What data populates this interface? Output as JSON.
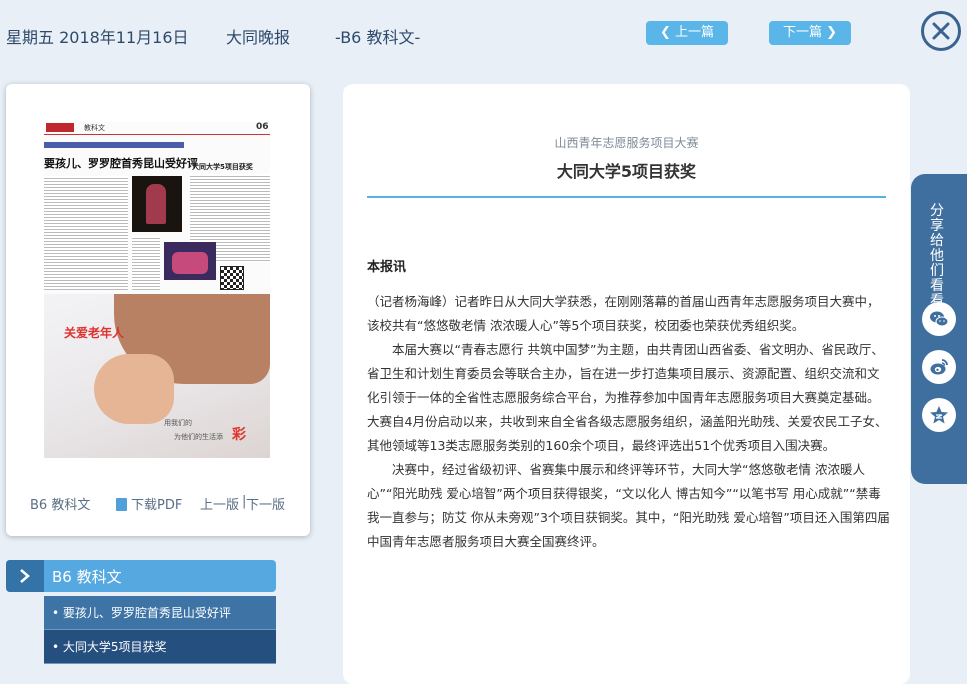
{
  "header": {
    "date": "星期五 2018年11月16日",
    "paper_name": "大同晚报",
    "page_section": "-B6 教科文-",
    "prev_label": "上一篇",
    "next_label": "下一篇"
  },
  "thumbnail": {
    "section_title": "教科文",
    "page_number": "06",
    "headline": "要孩儿、罗罗腔首秀昆山受好评",
    "side_headline": "大同大学5项目获奖",
    "ad_title": "关爱老年人",
    "ad_line1": "用我们的",
    "ad_line2": "为他们的生活添",
    "ad_line3": "彩"
  },
  "card_links": {
    "page": "B6 教科文",
    "download_pdf": "下载PDF",
    "prev_page": "上一版",
    "separator": "|",
    "next_page": "下一版"
  },
  "section_nav": {
    "title": "B6 教科文",
    "items": [
      {
        "label": "• 要孩儿、罗罗腔首秀昆山受好评"
      },
      {
        "label": "• 大同大学5项目获奖"
      }
    ]
  },
  "article": {
    "kicker": "山西青年志愿服务项目大赛",
    "title": "大同大学5项目获奖",
    "lead": "本报讯",
    "paragraphs": [
      "（记者杨海峰）记者昨日从大同大学获悉，在刚刚落幕的首届山西青年志愿服务项目大赛中，该校共有“悠悠敬老情 浓浓暖人心”等5个项目获奖，校团委也荣获优秀组织奖。",
      "本届大赛以“青春志愿行 共筑中国梦”为主题，由共青团山西省委、省文明办、省民政厅、省卫生和计划生育委员会等联合主办，旨在进一步打造集项目展示、资源配置、组织交流和文化引领于一体的全省性志愿服务综合平台，为推荐参加中国青年志愿服务项目大赛奠定基础。大赛自4月份启动以来，共收到来自全省各级志愿服务组织，涵盖阳光助残、关爱农民工子女、其他领域等13类志愿服务类别的160余个项目，最终评选出51个优秀项目入围决赛。",
      "决赛中，经过省级初评、省赛集中展示和终评等环节，大同大学“悠悠敬老情 浓浓暖人心”“阳光助残 爱心培智”两个项目获得银奖，“文以化人 博古知今”“以笔书写 用心成就”“禁毒我一直参与；防艾 你从未旁观”3个项目获铜奖。其中，“阳光助残 爱心培智”项目还入围第四届中国青年志愿者服务项目大赛全国赛终评。"
    ]
  },
  "share": {
    "label": "分享给他们看看",
    "icons": [
      "wechat-icon",
      "weibo-icon",
      "qzone-icon"
    ]
  },
  "colors": {
    "accent": "#58b0e3",
    "nav_dark": "#3e73a6",
    "page_bg": "#e8eff7"
  }
}
